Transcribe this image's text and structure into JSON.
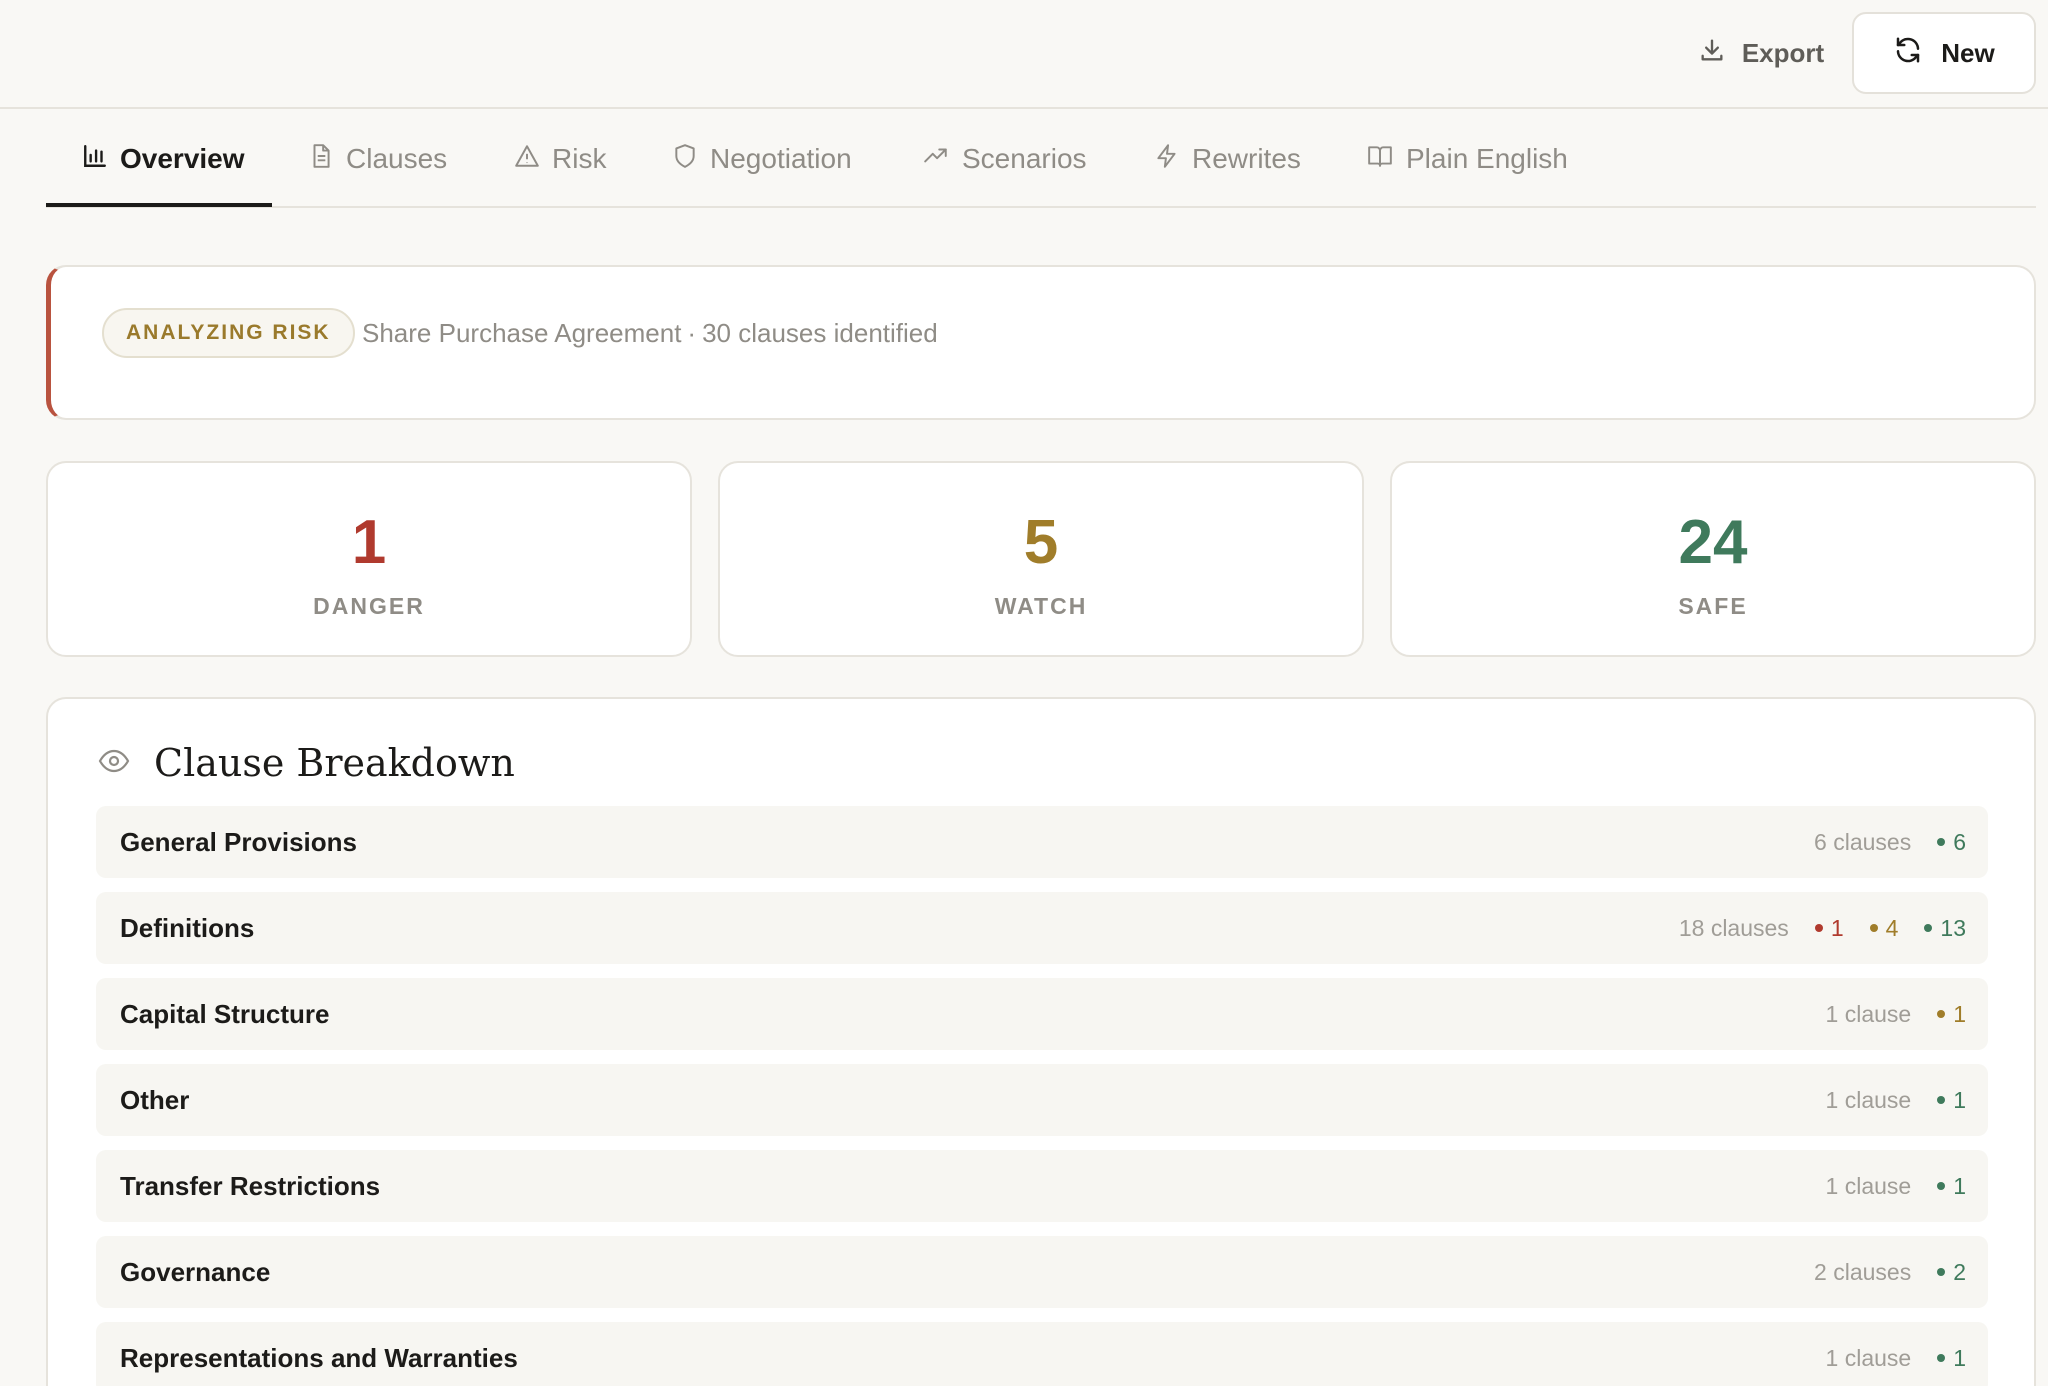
{
  "header": {
    "export_label": "Export",
    "new_label": "New"
  },
  "tabs": [
    {
      "label": "Overview",
      "icon": "bar-chart-icon",
      "active": true
    },
    {
      "label": "Clauses",
      "icon": "document-icon",
      "active": false
    },
    {
      "label": "Risk",
      "icon": "warning-icon",
      "active": false
    },
    {
      "label": "Negotiation",
      "icon": "shield-icon",
      "active": false
    },
    {
      "label": "Scenarios",
      "icon": "trending-up-icon",
      "active": false
    },
    {
      "label": "Rewrites",
      "icon": "lightning-icon",
      "active": false
    },
    {
      "label": "Plain English",
      "icon": "book-icon",
      "active": false
    }
  ],
  "status": {
    "badge": "ANALYZING RISK",
    "document": "Share Purchase Agreement",
    "separator": "·",
    "clause_summary": "30 clauses identified"
  },
  "stats": {
    "danger": {
      "value": "1",
      "label": "DANGER"
    },
    "watch": {
      "value": "5",
      "label": "WATCH"
    },
    "safe": {
      "value": "24",
      "label": "SAFE"
    }
  },
  "breakdown": {
    "title": "Clause Breakdown",
    "rows": [
      {
        "name": "General Provisions",
        "count": "6 clauses",
        "danger": null,
        "watch": null,
        "safe": "6"
      },
      {
        "name": "Definitions",
        "count": "18 clauses",
        "danger": "1",
        "watch": "4",
        "safe": "13"
      },
      {
        "name": "Capital Structure",
        "count": "1 clause",
        "danger": null,
        "watch": "1",
        "safe": null
      },
      {
        "name": "Other",
        "count": "1 clause",
        "danger": null,
        "watch": null,
        "safe": "1"
      },
      {
        "name": "Transfer Restrictions",
        "count": "1 clause",
        "danger": null,
        "watch": null,
        "safe": "1"
      },
      {
        "name": "Governance",
        "count": "2 clauses",
        "danger": null,
        "watch": null,
        "safe": "2"
      },
      {
        "name": "Representations and Warranties",
        "count": "1 clause",
        "danger": null,
        "watch": null,
        "safe": "1"
      }
    ]
  },
  "colors": {
    "danger": "#b03a2e",
    "watch": "#a07d2a",
    "safe": "#3f7a5c",
    "accent_border": "#b9533f"
  }
}
